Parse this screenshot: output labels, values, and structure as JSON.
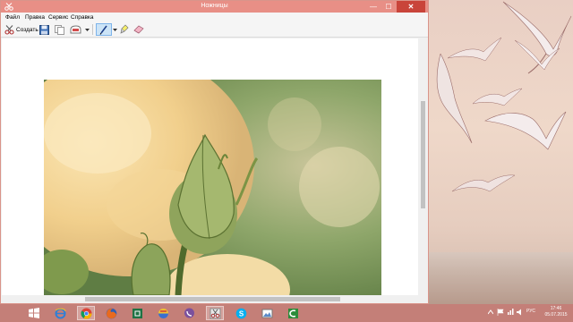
{
  "window": {
    "title": "Ножницы",
    "controls": {
      "minimize": "—",
      "maximize": "☐",
      "close": "✕"
    }
  },
  "menu": [
    "Файл",
    "Правка",
    "Сервис",
    "Справка"
  ],
  "toolbar": {
    "new_label": "Создать",
    "icons": [
      "scissors-icon",
      "save-icon",
      "copy-icon",
      "send-icon",
      "pen-icon",
      "highlighter-icon",
      "eraser-icon"
    ]
  },
  "colors": {
    "titlebar": "#e88f86",
    "close_button": "#c9443a",
    "taskbar": "#c47f78",
    "pen_highlight": "#cce4f7"
  },
  "taskbar": {
    "apps": [
      "windows-start-icon",
      "internet-explorer-icon",
      "chrome-icon",
      "firefox-icon",
      "excel-icon",
      "color-app-icon",
      "viber-icon",
      "snipping-tool-icon",
      "skype-icon",
      "photos-icon",
      "camtasia-icon"
    ],
    "tray_lang": "РУС",
    "time": "17:46",
    "date": "05.07.2015"
  }
}
